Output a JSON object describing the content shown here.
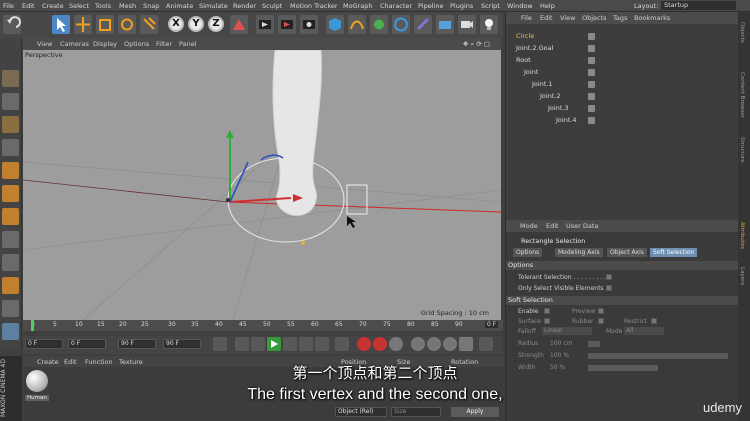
{
  "menubar": {
    "items": [
      "File",
      "Edit",
      "Create",
      "Select",
      "Tools",
      "Mesh",
      "Snap",
      "Animate",
      "Simulate",
      "Render",
      "Sculpt",
      "Motion Tracker",
      "MoGraph",
      "Character",
      "Pipeline",
      "Plugins",
      "Script",
      "Window",
      "Help"
    ],
    "layout_label": "Layout:",
    "layout_value": "Startup"
  },
  "viewport": {
    "menu": [
      "View",
      "Cameras",
      "Display",
      "Options",
      "Filter",
      "Panel"
    ],
    "camera_label": "Perspective",
    "grid_spacing": "Grid Spacing : 10 cm"
  },
  "toolbar": {
    "axis_x": "X",
    "axis_y": "Y",
    "axis_z": "Z"
  },
  "timeline": {
    "ticks": [
      "0",
      "5",
      "10",
      "15",
      "20",
      "25",
      "30",
      "35",
      "40",
      "45",
      "50",
      "55",
      "60",
      "65",
      "70",
      "75",
      "80",
      "85",
      "90"
    ],
    "end_frame": "0 F"
  },
  "transport": {
    "start_field": "0 F",
    "current_field": "0 F",
    "end_field": "90 F",
    "max_field": "90 F"
  },
  "materials": {
    "menu": [
      "Create",
      "Edit",
      "Function",
      "Texture"
    ],
    "swatch_label": "Human",
    "coord_labels": [
      "Position",
      "Size",
      "Rotation"
    ],
    "apply_dropdown": "Object (Rel)",
    "apply_size_dropdown": "Size",
    "apply_button": "Apply"
  },
  "brand": {
    "product": "MAXON CINEMA 4D"
  },
  "objects": {
    "menu": [
      "File",
      "Edit",
      "View",
      "Objects",
      "Tags",
      "Bookmarks"
    ],
    "tree": [
      {
        "name": "Circle",
        "level": 0,
        "selected": false
      },
      {
        "name": "Joint.2.Goal",
        "level": 0,
        "selected": false
      },
      {
        "name": "Root",
        "level": 0,
        "selected": false
      },
      {
        "name": "Joint",
        "level": 1,
        "selected": false
      },
      {
        "name": "Joint.1",
        "level": 2,
        "selected": false
      },
      {
        "name": "Joint.2",
        "level": 3,
        "selected": false
      },
      {
        "name": "Joint.3",
        "level": 4,
        "selected": false
      },
      {
        "name": "Joint.4",
        "level": 5,
        "selected": false
      }
    ]
  },
  "attributes": {
    "menu": [
      "Mode",
      "Edit",
      "User Data"
    ],
    "title": "Rectangle Selection",
    "tabs": [
      "Options",
      "Modeling Axis",
      "Object Axis",
      "Soft Selection"
    ],
    "active_tab": "Soft Selection",
    "options_header": "Options",
    "options": [
      "Tolerant Selection . . . . . . . . .",
      "Only Select Visible Elements"
    ],
    "soft_header": "Soft Selection",
    "enable_label": "Enable",
    "preview_label": "Preview",
    "surface_label": "Surface",
    "rubber_label": "Rubber",
    "restrict_label": "Restrict",
    "falloff_label": "Falloff",
    "falloff_value": "Linear",
    "mode_label": "Mode",
    "mode_value": "All",
    "radius_label": "Radius",
    "radius_value": "100 cm",
    "strength_label": "Strength",
    "strength_value": "100 %",
    "width_label": "Width",
    "width_value": "50 %"
  },
  "rightstrip": [
    "Objects",
    "Content Browser",
    "Structure",
    "Attributes",
    "Layers"
  ],
  "captions": {
    "chinese": "第一个顶点和第二个顶点",
    "english": "The first vertex and the second one,"
  },
  "watermark": "udemy",
  "colors": {
    "accent_tab": "#6f8fb2",
    "axis_x": "#d24040",
    "axis_y": "#3cae3c",
    "axis_z": "#4a6fd8"
  }
}
